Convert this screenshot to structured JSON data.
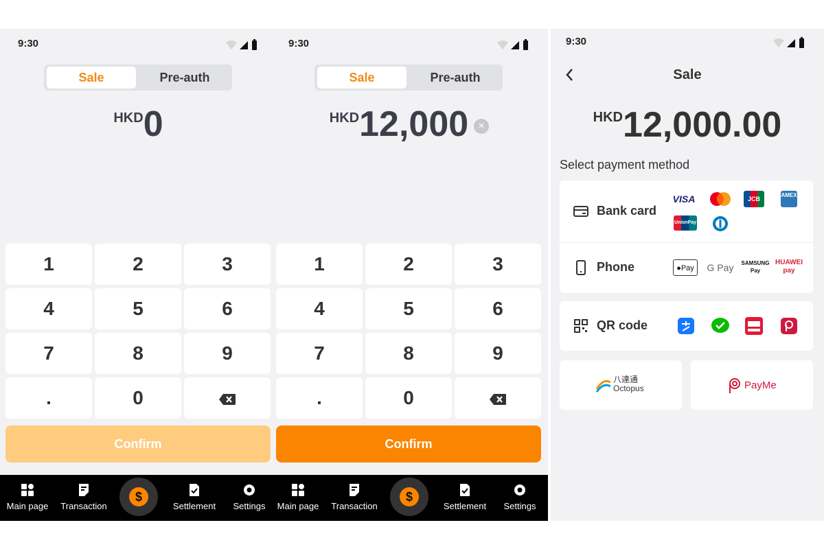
{
  "status": {
    "time": "9:30"
  },
  "tabs": {
    "sale": "Sale",
    "preauth": "Pre-auth"
  },
  "currency": "HKD",
  "screen1": {
    "amount": "0"
  },
  "screen2": {
    "amount": "12,000"
  },
  "keys": [
    "1",
    "2",
    "3",
    "4",
    "5",
    "6",
    "7",
    "8",
    "9",
    ".",
    "0"
  ],
  "confirm_label": "Confirm",
  "nav": [
    "Main page",
    "Transaction",
    "Settlement",
    "Settings"
  ],
  "screen3": {
    "title": "Sale",
    "amount": "12,000.00",
    "select_label": "Select payment method",
    "bank_card": "Bank card",
    "phone": "Phone",
    "qr_code": "QR code",
    "visa": "VISA",
    "jcb": "JCB",
    "amex": "AMEX",
    "unionpay": "UnionPay",
    "apple_pay": "Pay",
    "google_pay": "G Pay",
    "samsung_pay": "SAMSUNG Pay",
    "huawei_pay": "HUAWEI pay",
    "octopus_cn": "八達通",
    "octopus": "Octopus",
    "payme": "PayMe"
  },
  "colors": {
    "accent": "#fb8500",
    "accent_disabled": "#fecb7f",
    "background": "#f2f2f4"
  }
}
